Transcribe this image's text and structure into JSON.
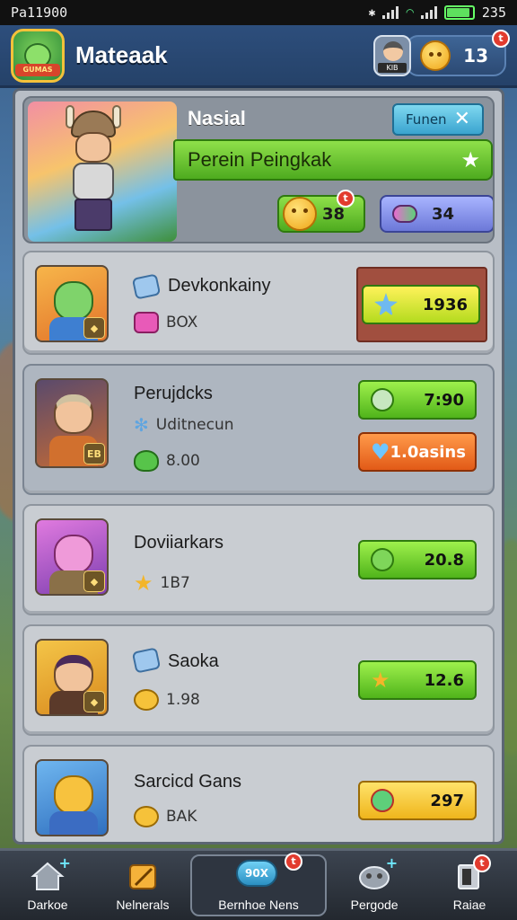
{
  "status_bar": {
    "carrier": "Pa11900",
    "time": "235"
  },
  "header": {
    "title": "Mateaak",
    "logo_text": "GUMAS",
    "profile_tag": "KIB",
    "coin_count": "13",
    "coin_badge": "t"
  },
  "featured": {
    "title": "Nasial",
    "tag_button": "Funen",
    "banner": "Perein Peingkak",
    "coin_value": "38",
    "coin_badge": "t",
    "gem_value": "34"
  },
  "cards": [
    {
      "name": "Devkonkainy",
      "sub_label": "BOX",
      "button_value": "1936",
      "button_style": "green"
    },
    {
      "name": "Perujdcks",
      "desc": "Uditnecun",
      "level": "EB",
      "stat_value": "8.00",
      "button_value": "7:90",
      "button_style": "green",
      "button2_value": "1.0asins",
      "button2_style": "orange"
    },
    {
      "name": "Doviiarkars",
      "stat_value": "1B7",
      "button_value": "20.8",
      "button_style": "green"
    },
    {
      "name": "Saoka",
      "stat_value": "1.98",
      "button_value": "12.6",
      "button_style": "green"
    },
    {
      "name": "Sarcicd Gans",
      "sub_label": "BAK",
      "button_value": "297",
      "button_style": "yellow"
    }
  ],
  "bottom_nav": [
    {
      "label": "Darkoe",
      "icon": "home-icon"
    },
    {
      "label": "Nelnerals",
      "icon": "pencil-icon"
    },
    {
      "label": "Bernhoe Nens",
      "icon": "badge-icon",
      "icon_text": "90X",
      "badge": "t",
      "active": true
    },
    {
      "label": "Pergode",
      "icon": "controller-icon"
    },
    {
      "label": "Raiae",
      "icon": "exit-icon",
      "badge": "t"
    }
  ],
  "colors": {
    "accent_green": "#50b41b",
    "accent_orange": "#e25a17",
    "accent_yellow": "#efb51c",
    "badge_red": "#e23b2e"
  }
}
